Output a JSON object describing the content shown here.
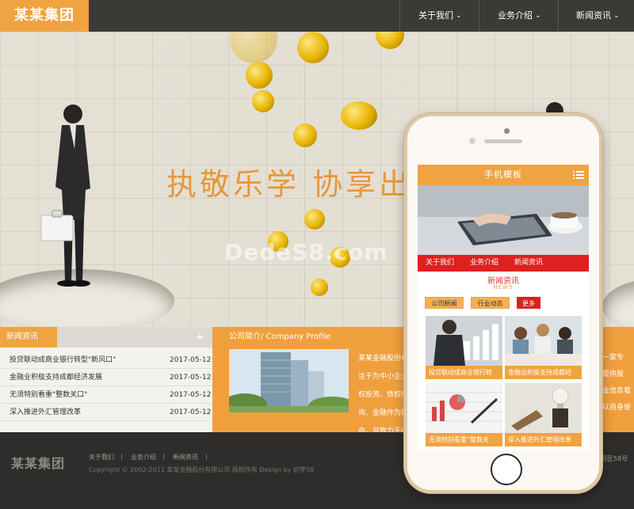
{
  "header": {
    "logo": "某某集团",
    "nav": [
      {
        "label": "关于我们"
      },
      {
        "label": "业务介绍"
      },
      {
        "label": "新闻资讯"
      }
    ]
  },
  "hero": {
    "slogan": "执敬乐学  协享出",
    "watermark": "DedeS8.com"
  },
  "news": {
    "title": "新闻资讯",
    "more": "+",
    "items": [
      {
        "title": "投贷联动成商业银行转型\"新风口\"",
        "date": "2017-05-12"
      },
      {
        "title": "金融业积极支持成都经济发展",
        "date": "2017-05-12"
      },
      {
        "title": "无须特别看重\"整数关口\"",
        "date": "2017-05-12"
      },
      {
        "title": "深入推进外汇管理改革",
        "date": "2017-05-12"
      }
    ]
  },
  "about": {
    "title": "公司简介/ Company Profile",
    "more": "+",
    "lines": [
      "某某金融股份有",
      "注于为中小企业",
      "权投资、债权投",
      "询、金融作为联",
      "命，并致力于成"
    ]
  },
  "right_panel": {
    "lines": [
      "一家专",
      "提供股",
      "业信息着",
      "以自身使"
    ]
  },
  "footer": {
    "logo": "某某集团",
    "links": [
      "关于我们",
      "业务介绍",
      "新闻资讯"
    ],
    "separator": "|",
    "copyright": "Copyright © 2002-2011 某某金融股份有限公司 版权所有 Design by 织梦58",
    "address": "河区58号"
  },
  "mobile": {
    "title": "手机模板",
    "nav": [
      "关于我们",
      "业务介绍",
      "新闻资讯"
    ],
    "section_title": "新闻资讯",
    "section_en": "NEWS",
    "tabs": [
      "公司新闻",
      "行业动态",
      "更多"
    ],
    "cards": [
      {
        "caption": "投贷联动成商业银行转"
      },
      {
        "caption": "金融业积极支持成都经"
      },
      {
        "caption": "无须特别看重“整数关"
      },
      {
        "caption": "深入推进外汇管理改革"
      }
    ]
  },
  "colors": {
    "accent": "#f0a341",
    "header_bg": "#3c3a37",
    "footer_bg": "#2f2d2b",
    "mobile_nav": "#e01f1f"
  },
  "icons": [
    "chevron-down-icon",
    "plus-icon",
    "menu-icon"
  ]
}
